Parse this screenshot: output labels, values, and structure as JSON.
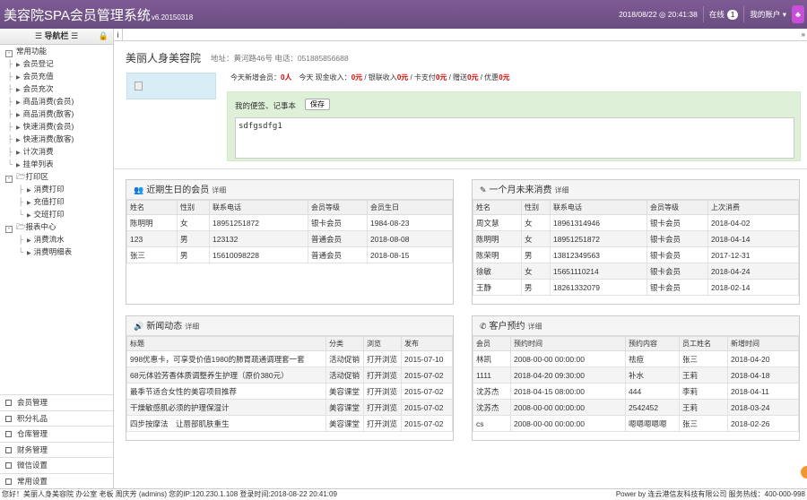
{
  "app": {
    "title": "美容院SPA会员管理系统",
    "version": "v6.20150318",
    "datetime": "2018/08/22 ◎ 20:41:38",
    "online_label": "在线",
    "online_count": "1",
    "account_label": "我的账户"
  },
  "sidebar": {
    "header": "☰ 导航栏 ☰",
    "sections": [
      {
        "label": "常用功能",
        "items": [
          "会员登记",
          "会员充值",
          "会员充次",
          "商品消费(会员)",
          "商品消费(散客)",
          "快速消费(会员)",
          "快速消费(散客)",
          "计次消费",
          "挂单列表"
        ]
      },
      {
        "label": "打印区",
        "items": [
          "消费打印",
          "充值打印",
          "交班打印"
        ]
      },
      {
        "label": "报表中心",
        "items": [
          "消费流水",
          "消费明细表"
        ]
      }
    ],
    "bottom": [
      "会员管理",
      "积分礼品",
      "仓库管理",
      "财务管理",
      "微信设置",
      "常用设置"
    ]
  },
  "main": {
    "shop_name": "美丽人身美容院",
    "shop_address": "地址：黄河路46号 电话：051885856688",
    "stats": [
      {
        "label": "今天新增会员：",
        "value": "0人"
      },
      {
        "label": "今天 现金收入：",
        "value": "0元"
      },
      {
        "label": " / 银联收入",
        "value": "0元"
      },
      {
        "label": " / 卡支付",
        "value": "0元"
      },
      {
        "label": " / 赠送",
        "value": "0元"
      },
      {
        "label": " / 优惠",
        "value": "0元"
      }
    ],
    "memo_label": "我的便签、记事本",
    "memo_save": "保存",
    "memo_text": "sdfgsdfg1"
  },
  "panels": {
    "birthday": {
      "title": "近期生日的会员",
      "detail": "详细",
      "headers": [
        "姓名",
        "性别",
        "联系电话",
        "会员等级",
        "会员生日"
      ],
      "rows": [
        [
          "陈明明",
          "女",
          "18951251872",
          "银卡会员",
          "1984-08-23"
        ],
        [
          "123",
          "男",
          "123132",
          "普通会员",
          "2018-08-08"
        ],
        [
          "张三",
          "男",
          "15610098228",
          "普通会员",
          "2018-08-15"
        ]
      ]
    },
    "noconsume": {
      "title": "一个月未来消费",
      "detail": "详细",
      "headers": [
        "姓名",
        "性别",
        "联系电话",
        "会员等级",
        "上次消费"
      ],
      "rows": [
        [
          "周文慧",
          "女",
          "18961314946",
          "银卡会员",
          "2018-04-02"
        ],
        [
          "陈明明",
          "女",
          "18951251872",
          "银卡会员",
          "2018-04-14"
        ],
        [
          "陈荣明",
          "男",
          "13812349563",
          "银卡会员",
          "2017-12-31"
        ],
        [
          "徐敏",
          "女",
          "15651110214",
          "银卡会员",
          "2018-04-24"
        ],
        [
          "王静",
          "男",
          "18261332079",
          "银卡会员",
          "2018-02-14"
        ]
      ]
    },
    "news": {
      "title": "新闻动态",
      "detail": "详细",
      "headers": [
        "标题",
        "分类",
        "浏览",
        "发布"
      ],
      "rows": [
        [
          "998优惠卡，可享受价值1980的肺胃疏通调理套一套",
          "活动促销",
          "打开浏览",
          "2015-07-10"
        ],
        [
          "68元体验芳香体质调整养生护理（原价380元）",
          "活动促销",
          "打开浏览",
          "2015-07-02"
        ],
        [
          "最季节适合女性的美容项目推荐",
          "美容课堂",
          "打开浏览",
          "2015-07-02"
        ],
        [
          "干燥敏感肌必须的护理保湿计",
          "美容课堂",
          "打开浏览",
          "2015-07-02"
        ],
        [
          "四步按摩法　让唇部肌肤重生",
          "美容课堂",
          "打开浏览",
          "2015-07-02"
        ]
      ]
    },
    "booking": {
      "title": "客户预约",
      "detail": "详细",
      "headers": [
        "会员",
        "预约时间",
        "预约内容",
        "员工姓名",
        "新增时间"
      ],
      "rows": [
        [
          "林凯",
          "2008-00-00 00:00:00",
          "祛痘",
          "张三",
          "2018-04-20"
        ],
        [
          "1111",
          "2018-04-20 09:30:00",
          "补水",
          "王莉",
          "2018-04-18"
        ],
        [
          "沈苏杰",
          "2018-04-15 08:00:00",
          "444",
          "李莉",
          "2018-04-11"
        ],
        [
          "沈苏杰",
          "2008-00-00 00:00:00",
          "2542452",
          "王莉",
          "2018-03-24"
        ],
        [
          "cs",
          "2008-00-00 00:00:00",
          "嗯嗯嗯嗯嗯",
          "张三",
          "2018-02-26"
        ]
      ]
    }
  },
  "status": {
    "left": "您好！美丽人身美容院 办公室 老板 周庆芳 (admins) 您的IP:120.230.1.108 登录时间:2018-08-22 20:41:09",
    "right": "Power by 连云港信友科技有限公司 服务热线：400-000-998"
  }
}
